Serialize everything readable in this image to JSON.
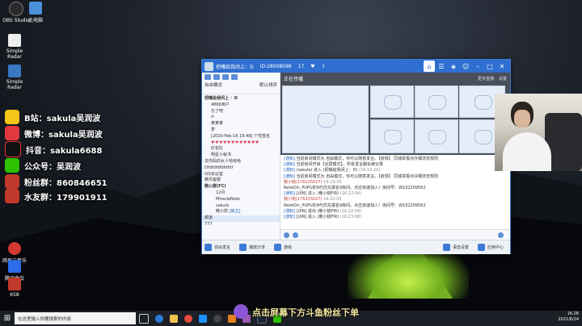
{
  "desktop": {
    "icons": [
      {
        "label": "OBS Studio",
        "color": "#2a2a2a"
      },
      {
        "label": "此电脑",
        "color": "#4a90d9"
      },
      {
        "label": "Simple Radar",
        "color": "#eeeeee"
      },
      {
        "label": "Simple Radar",
        "color": "#3b78c2"
      },
      {
        "label": "QQ",
        "color": "#ffd000"
      },
      {
        "label": "Steam",
        "color": "#1b2838"
      },
      {
        "label": "抖音",
        "color": "#111111"
      },
      {
        "label": "微信",
        "color": "#2dc100"
      },
      {
        "label": "全民K歌",
        "color": "#e23c3c"
      },
      {
        "label": "网易云音乐",
        "color": "#d33a31"
      },
      {
        "label": "腾讯会议",
        "color": "#2b6de8"
      },
      {
        "label": "658",
        "color": "#c0392b"
      }
    ]
  },
  "overlay": {
    "lines": [
      {
        "text": "B站：sakula吴润波",
        "color": "#f5c518"
      },
      {
        "text": "微博：sakula吴润波",
        "color": "#e0383e"
      },
      {
        "text": "抖音：sakula6688",
        "color": "#111111"
      },
      {
        "text": "公众号：吴润波",
        "color": "#2dc100"
      },
      {
        "text": "粉丝群：860846651",
        "color": "#111111"
      },
      {
        "text": "水友群：179901911",
        "color": "#111111"
      }
    ]
  },
  "chat_window": {
    "title": "把嘴给我闭上：D",
    "room_id": "ID:28008098",
    "online": "17",
    "left_panel": {
      "mode_label": "自由模式",
      "sort_label": "默认排序",
      "group_title": "把嘴给我闭上 ：D",
      "members": [
        "4866用户",
        "忘了吧",
        "rt",
        "某某某",
        "梦"
      ],
      "status_line": "[2020-Feb-16 19:48] 个性签名",
      "hearts": "♥♥♥♥♥♥♥♥♥♥♥♥",
      "sub_groups": [
        "红包队",
        "明星小秘书"
      ],
      "channels": [
        "去你妈的女人哈哈哈",
        "Dfdfdfdfdfdfdf",
        "QQ会议室",
        "腾讯客服"
      ],
      "group2_title": "散心群(FC)",
      "group2_members": [
        "12月",
        "MiracleNote",
        "sakula",
        "韩小样"
      ],
      "footer": [
        "频道",
        "777"
      ],
      "footer_selected": "频道",
      "member_badge": "[房主]"
    },
    "right_panel": {
      "header": "正在传播",
      "more": "更多直播",
      "settings": "设置"
    },
    "messages": [
      {
        "prefix": "[通知]",
        "text": "当前房间模式为 自由模式，你可以随意发言。【房规】 同城举报点仔细浏览规则"
      },
      {
        "prefix": "[通知]",
        "text": "当前房间开启【全屏模式】，所有发言都会被记录"
      },
      {
        "prefix": "[通知]",
        "text": "(sakula) 进入 (把嘴给我闭上：D)",
        "time": "(16:19:20)"
      },
      {
        "prefix": "[通知]",
        "text": "当前房间模式为 自由模式，你可以随意发言。【房规】 同城举报点仔细浏览规则"
      },
      {
        "prefix": "",
        "user": "散小桃(176225027)",
        "time": "16:19:26",
        "text": "ReletOn_PUPU的9代优先报名9房间。点击快速加入！房间号：W102209562"
      },
      {
        "prefix": "[通知]",
        "text": "[UIN] 进入 (散小桃FIR)",
        "time": "(16:22:04)"
      },
      {
        "prefix": "",
        "user": "散小桃(176225027)",
        "time": "16:22:05",
        "text": "ReletOn_PUPU的9代优先报名9房间。点击快速加入！房间号：W102209562"
      },
      {
        "prefix": "[通知]",
        "text": "[UIN] 退出 (散小桃FIR)",
        "time": "(16:22:59)"
      },
      {
        "prefix": "[通知]",
        "text": "[UIN] 进入 (散小桃FIR)",
        "time": "(16:23:08)"
      }
    ],
    "bottom_bar": {
      "mic": "自由发言",
      "share": "播放分享",
      "game": "游戏",
      "voice": "语音设置",
      "app": "应用中心"
    }
  },
  "taskbar": {
    "search_placeholder": "在这里输入你要搜索的内容",
    "time": "16:28",
    "date": "2021/6/24"
  },
  "subtitle": "点击屏幕下方斗鱼粉丝下单"
}
